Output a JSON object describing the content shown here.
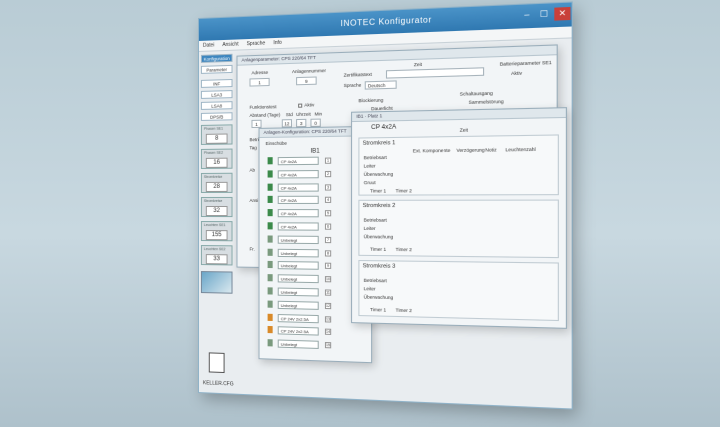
{
  "app": {
    "title": "INOTEC Konfigurator",
    "min": "–",
    "max": "☐",
    "close": "✕"
  },
  "menu": [
    "Datei",
    "Ansicht",
    "Sprache",
    "Info"
  ],
  "sidebar": {
    "buttons": [
      "Konfiguration",
      "Parameter",
      "INF",
      "LSA3",
      "LSA8",
      "DPS/B"
    ],
    "boxes": [
      {
        "label": "Phasen SE1",
        "value": "8"
      },
      {
        "label": "Phasen SE2",
        "value": "16"
      },
      {
        "label": "Stromkreise",
        "value": "28"
      },
      {
        "label": "Stromkreise",
        "value": "32"
      },
      {
        "label": "Leuchten SE1",
        "value": "155"
      },
      {
        "label": "Leuchten SE2",
        "value": "33"
      }
    ],
    "file": "KELLER.CFG"
  },
  "anlage": {
    "title": "Anlagenparameter: CPS 220/64 TFT",
    "adresse_label": "Adresse",
    "adresse": "1",
    "nummer_label": "Anlagennummer",
    "nummer": "9",
    "zeit_label": "Zeit",
    "zertifikat_label": "Zertifikatstext",
    "sprache_label": "Sprache",
    "sprache": "Deutsch",
    "battery_label": "Batterieparameter SE1",
    "battery_opt": "Aktiv",
    "funktionstest": "Funktionstest",
    "aktiv": "Aktiv",
    "abstand": "Abstand (Tage)",
    "std": "Std",
    "uhrzeit": "Uhrzeit",
    "min": "Min",
    "vals": [
      "1",
      "12",
      "3",
      "0"
    ],
    "blockierung": "Blockierung",
    "dauerlicht": "Dauerlicht",
    "sammelstoerung": "Sammelstörung",
    "betriebszeit": "Betrieb",
    "tag": "Tag",
    "abk": "Ab",
    "ansi": "Ansi",
    "frei1": "Fr.",
    "schalt": "Schaltausgang"
  },
  "einschuebe": {
    "title": "Anlagen-Konfiguration: CPS 220/64 TFT",
    "group": "Einschübe",
    "slot_header": "IB1",
    "slots": [
      {
        "type": "CP 4x2A",
        "n": "1"
      },
      {
        "type": "CP 4x2A",
        "n": "2"
      },
      {
        "type": "CP 4x2A",
        "n": "3"
      },
      {
        "type": "CP 4x2A",
        "n": "4"
      },
      {
        "type": "CP 4x2A",
        "n": "5"
      },
      {
        "type": "CP 4x2A",
        "n": "6"
      },
      {
        "type": "Unbelegt",
        "n": "7"
      },
      {
        "type": "Unbelegt",
        "n": "8"
      },
      {
        "type": "Unbelegt",
        "n": "9"
      },
      {
        "type": "Unbelegt",
        "n": "10"
      },
      {
        "type": "Unbelegt",
        "n": "11"
      },
      {
        "type": "Unbelegt",
        "n": "12"
      },
      {
        "type": "CP 24V 2x2.5A",
        "n": "13"
      },
      {
        "type": "CP 24V 2x2.5A",
        "n": "14"
      },
      {
        "type": "Unbelegt",
        "n": "15"
      }
    ]
  },
  "platz": {
    "title": "IB1 · Platz 1",
    "module": "CP 4x2A",
    "zeit": "Zeit",
    "cols": [
      "Ext. Komponente",
      "Verzögerung",
      "Notiz",
      "Leuchtenzahl"
    ],
    "rows": [
      "Betriebsart",
      "Leiter",
      "Überwachung",
      "Gruut"
    ],
    "timer1": "Timer 1",
    "timer2": "Timer 2",
    "circuits": [
      "Stromkreis 1",
      "Stromkreis 2",
      "Stromkreis 3"
    ]
  }
}
